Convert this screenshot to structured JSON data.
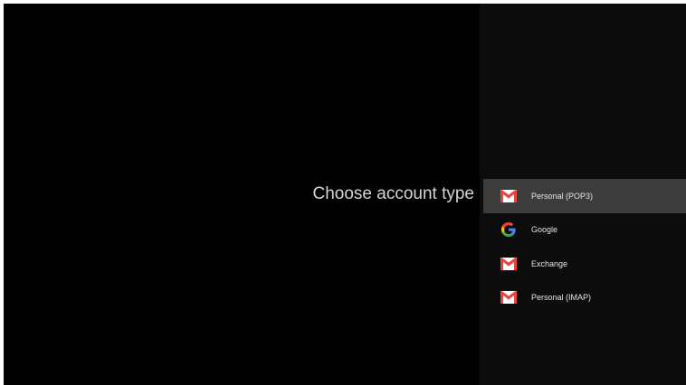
{
  "title": "Choose account type",
  "account_types": [
    {
      "label": "Personal (POP3)",
      "icon": "gmail-icon",
      "selected": true
    },
    {
      "label": "Google",
      "icon": "google-icon",
      "selected": false
    },
    {
      "label": "Exchange",
      "icon": "gmail-icon",
      "selected": false
    },
    {
      "label": "Personal (IMAP)",
      "icon": "gmail-icon",
      "selected": false
    }
  ],
  "colors": {
    "background": "#000000",
    "panel": "#0c0c0c",
    "selected_row": "#3c3c3c",
    "gmail_red": "#e8453c",
    "text": "#e6e6e6"
  }
}
